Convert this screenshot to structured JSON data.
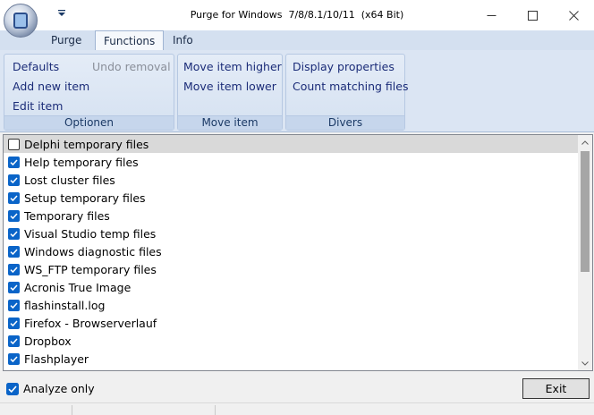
{
  "window": {
    "title": "Purge for Windows  7/8/8.1/10/11  (x64 Bit)",
    "app_icon": "purge-app-icon",
    "quick_access_icon": "dropdown-arrow-icon"
  },
  "tabs": [
    {
      "label": "Purge",
      "active": false
    },
    {
      "label": "Functions",
      "active": true
    },
    {
      "label": "Info",
      "active": false
    }
  ],
  "ribbon": {
    "optionen": {
      "label": "Optionen",
      "defaults": "Defaults",
      "undo_removal": "Undo removal",
      "add_new_item": "Add new item",
      "edit_item": "Edit item"
    },
    "move_item": {
      "label": "Move item",
      "move_higher": "Move item higher",
      "move_lower": "Move item lower"
    },
    "divers": {
      "label": "Divers",
      "display_properties": "Display properties",
      "count_matching_files": "Count matching files"
    }
  },
  "list": {
    "items": [
      {
        "label": "Delphi temporary files",
        "checked": false
      },
      {
        "label": "Help temporary files",
        "checked": true
      },
      {
        "label": "Lost cluster files",
        "checked": true
      },
      {
        "label": "Setup temporary files",
        "checked": true
      },
      {
        "label": "Temporary files",
        "checked": true
      },
      {
        "label": "Visual Studio temp files",
        "checked": true
      },
      {
        "label": "Windows diagnostic files",
        "checked": true
      },
      {
        "label": "WS_FTP temporary files",
        "checked": true
      },
      {
        "label": "Acronis True Image",
        "checked": true
      },
      {
        "label": "flashinstall.log",
        "checked": true
      },
      {
        "label": "Firefox - Browserverlauf",
        "checked": true
      },
      {
        "label": "Dropbox",
        "checked": true
      },
      {
        "label": "Flashplayer",
        "checked": true
      }
    ]
  },
  "bottom": {
    "analyze_label": "Analyze only",
    "analyze_checked": true,
    "exit_label": "Exit"
  },
  "colors": {
    "accent": "#0a64c8",
    "ribbon_bg": "#dbe5f3",
    "ribbon_text": "#1b2c78"
  }
}
